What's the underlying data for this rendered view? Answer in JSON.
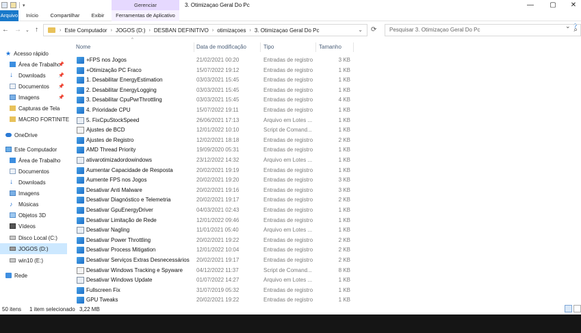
{
  "window": {
    "manage_tab": "Gerenciar",
    "title": "3. Otimizaçao Geral Do Pc",
    "controls": {
      "minimize": "—",
      "maximize": "▢",
      "close": "✕"
    }
  },
  "ribbon": {
    "tabs": [
      "Arquivo",
      "Início",
      "Compartilhar",
      "Exibir",
      "Ferramentas de Aplicativo"
    ]
  },
  "address": {
    "crumbs": [
      "Este Computador",
      "JOGOS (D:)",
      "DESBAN DEFINITIVO",
      "otimizaçoes",
      "3. Otimizaçao Geral Do Pc"
    ],
    "search_placeholder": "Pesquisar 3. Otimizaçao Geral Do Pc"
  },
  "navpane": {
    "quick_access": "Acesso rápido",
    "quick_items": [
      "Área de Trabalho",
      "Downloads",
      "Documentos",
      "Imagens",
      "Capturas de Tela",
      "MACRO FORTINITE"
    ],
    "onedrive": "OneDrive",
    "this_pc": "Este Computador",
    "pc_items": [
      "Área de Trabalho",
      "Documentos",
      "Downloads",
      "Imagens",
      "Músicas",
      "Objetos 3D",
      "Vídeos",
      "Disco Local (C:)",
      "JOGOS (D:)",
      "win10 (E:)"
    ],
    "network": "Rede"
  },
  "columns": {
    "name": "Nome",
    "date": "Data de modificação",
    "type": "Tipo",
    "size": "Tamanho"
  },
  "files": [
    {
      "name": "+FPS nos Jogos",
      "date": "21/02/2021 00:20",
      "type": "Entradas de registro",
      "size": "3 KB",
      "icon": "reg-icon"
    },
    {
      "name": "+Otimização PC Fraco",
      "date": "15/07/2022 19:12",
      "type": "Entradas de registro",
      "size": "1 KB",
      "icon": "reg-icon"
    },
    {
      "name": "1. Desabilitar EnergyEstimation",
      "date": "03/03/2021 15:45",
      "type": "Entradas de registro",
      "size": "1 KB",
      "icon": "reg-icon"
    },
    {
      "name": "2. Desabilitar EnergyLogging",
      "date": "03/03/2021 15:45",
      "type": "Entradas de registro",
      "size": "1 KB",
      "icon": "reg-icon"
    },
    {
      "name": "3. Desabilitar CpuPwrThrottling",
      "date": "03/03/2021 15:45",
      "type": "Entradas de registro",
      "size": "4 KB",
      "icon": "reg-icon"
    },
    {
      "name": "4. Prioridade CPU",
      "date": "15/07/2022 19:11",
      "type": "Entradas de registro",
      "size": "1 KB",
      "icon": "reg-icon"
    },
    {
      "name": "5. FixCpuStockSpeed",
      "date": "26/06/2021 17:13",
      "type": "Arquivo em Lotes ...",
      "size": "1 KB",
      "icon": "batch-icon"
    },
    {
      "name": "Ajustes de BCD",
      "date": "12/01/2022 10:10",
      "type": "Script de Comand...",
      "size": "1 KB",
      "icon": "cmd-icon"
    },
    {
      "name": "Ajustes de Registro",
      "date": "12/02/2021 18:18",
      "type": "Entradas de registro",
      "size": "2 KB",
      "icon": "reg-icon"
    },
    {
      "name": "AMD Thread Priority",
      "date": "19/09/2020 05:31",
      "type": "Entradas de registro",
      "size": "1 KB",
      "icon": "reg-icon"
    },
    {
      "name": "ativarotimizadordowindows",
      "date": "23/12/2022 14:32",
      "type": "Arquivo em Lotes ...",
      "size": "1 KB",
      "icon": "batch-icon"
    },
    {
      "name": "Aumentar Capacidade de Resposta",
      "date": "20/02/2021 19:19",
      "type": "Entradas de registro",
      "size": "1 KB",
      "icon": "reg-icon"
    },
    {
      "name": "Aumente FPS nos Jogos",
      "date": "20/02/2021 19:20",
      "type": "Entradas de registro",
      "size": "3 KB",
      "icon": "reg-icon"
    },
    {
      "name": "Desativar Anti Malware",
      "date": "20/02/2021 19:16",
      "type": "Entradas de registro",
      "size": "3 KB",
      "icon": "reg-icon"
    },
    {
      "name": "Desativar Diagnóstico e Telemetria",
      "date": "20/02/2021 19:17",
      "type": "Entradas de registro",
      "size": "2 KB",
      "icon": "reg-icon"
    },
    {
      "name": "Desativar GpuEnergyDriver",
      "date": "04/03/2021 02:43",
      "type": "Entradas de registro",
      "size": "1 KB",
      "icon": "reg-icon"
    },
    {
      "name": "Desativar Limitação de Rede",
      "date": "12/01/2022 09:46",
      "type": "Entradas de registro",
      "size": "1 KB",
      "icon": "reg-icon"
    },
    {
      "name": "Desativar Nagling",
      "date": "11/01/2021 05:40",
      "type": "Arquivo em Lotes ...",
      "size": "1 KB",
      "icon": "batch-icon"
    },
    {
      "name": "Desativar Power Throttling",
      "date": "20/02/2021 19:22",
      "type": "Entradas de registro",
      "size": "2 KB",
      "icon": "reg-icon"
    },
    {
      "name": "Desativar Process Mitigation",
      "date": "12/01/2022 10:04",
      "type": "Entradas de registro",
      "size": "2 KB",
      "icon": "reg-icon"
    },
    {
      "name": "Desativar Serviços Extras Desnecessários",
      "date": "20/02/2021 19:17",
      "type": "Entradas de registro",
      "size": "2 KB",
      "icon": "reg-icon"
    },
    {
      "name": "Desativar Windows Tracking e Spyware",
      "date": "04/12/2022 11:37",
      "type": "Script de Comand...",
      "size": "8 KB",
      "icon": "cmd-icon"
    },
    {
      "name": "Desativar Windows Update",
      "date": "01/07/2022 14:27",
      "type": "Arquivo em Lotes ...",
      "size": "1 KB",
      "icon": "batch-icon"
    },
    {
      "name": "Fullscreen Fix",
      "date": "31/07/2019 05:32",
      "type": "Entradas de registro",
      "size": "1 KB",
      "icon": "reg-icon"
    },
    {
      "name": "GPU Tweaks",
      "date": "20/02/2021 19:22",
      "type": "Entradas de registro",
      "size": "1 KB",
      "icon": "reg-icon"
    }
  ],
  "status": {
    "count": "50 itens",
    "selection": "1 item selecionado",
    "size": "3,22 MB"
  },
  "colors": {
    "accent": "#1979ca",
    "manage_tab": "#e6d9ff",
    "selected": "#cce8ff",
    "folder": "#e8c25b"
  }
}
